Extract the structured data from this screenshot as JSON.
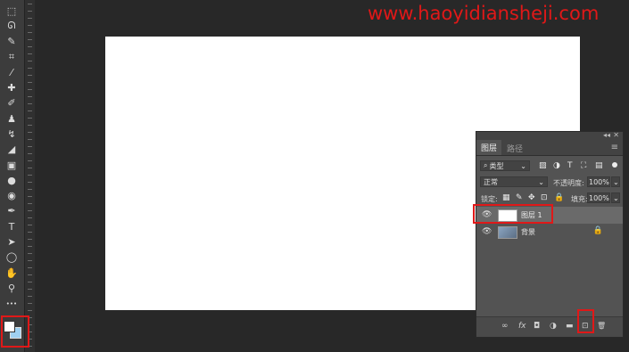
{
  "watermark": "www.haoyidiansheji.com",
  "tools": [
    {
      "name": "marquee-icon",
      "glyph": "⬚"
    },
    {
      "name": "lasso-icon",
      "glyph": "ᘏ"
    },
    {
      "name": "quick-select-icon",
      "glyph": "✎"
    },
    {
      "name": "crop-icon",
      "glyph": "⌗"
    },
    {
      "name": "eyedropper-icon",
      "glyph": "⁄"
    },
    {
      "name": "healing-brush-icon",
      "glyph": "✚"
    },
    {
      "name": "brush-icon",
      "glyph": "✐"
    },
    {
      "name": "clone-stamp-icon",
      "glyph": "♟"
    },
    {
      "name": "history-brush-icon",
      "glyph": "↯"
    },
    {
      "name": "eraser-icon",
      "glyph": "◢"
    },
    {
      "name": "gradient-icon",
      "glyph": "▣"
    },
    {
      "name": "blur-icon",
      "glyph": "●"
    },
    {
      "name": "dodge-icon",
      "glyph": "◉"
    },
    {
      "name": "pen-icon",
      "glyph": "✒"
    },
    {
      "name": "type-icon",
      "glyph": "T"
    },
    {
      "name": "path-select-icon",
      "glyph": "➤"
    },
    {
      "name": "ellipse-icon",
      "glyph": "◯"
    },
    {
      "name": "hand-icon",
      "glyph": "✋"
    },
    {
      "name": "zoom-icon",
      "glyph": "⚲"
    },
    {
      "name": "more-tools-icon",
      "glyph": "•••"
    }
  ],
  "panel": {
    "top_icons": {
      "collapse": "◂◂",
      "close": "✕"
    },
    "tabs": {
      "layers": "图层",
      "paths": "路径",
      "menu": "≡"
    },
    "filter": {
      "label": "类型",
      "search_glyph": "⌕"
    },
    "blend": {
      "mode": "正常",
      "opacity_label": "不透明度:",
      "opacity_value": "100%"
    },
    "lock": {
      "label": "锁定:",
      "fill_label": "填充:",
      "fill_value": "100%"
    },
    "layers": [
      {
        "name": "图层 1",
        "locked": false
      },
      {
        "name": "背景",
        "locked": true
      }
    ],
    "bottom": {
      "link": "∞",
      "fx": "fx",
      "mask": "◘",
      "adjust": "◑",
      "group": "▬",
      "new": "⊡",
      "delete": "🗑"
    }
  },
  "colors": {
    "highlight": "#e01818",
    "canvas": "#ffffff",
    "background_swatch": "#9fd0f0"
  }
}
